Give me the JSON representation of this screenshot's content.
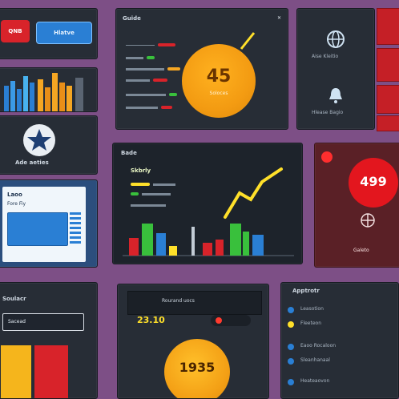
{
  "top_left": {
    "button_a": "QNB",
    "button_b": "Hlatve"
  },
  "gauge_panel": {
    "title": "Guide",
    "value": "45",
    "caption": "Soloces"
  },
  "icon_panel": {
    "item1": "Aise Kleitio",
    "item2": "Hlease Bagio"
  },
  "mid_left": {
    "label": "Ade aeties"
  },
  "form_panel": {
    "title": "Laoo",
    "field": "Fore Fiy"
  },
  "chart_panel": {
    "title": "Bade",
    "subtitle": "Skbrly"
  },
  "alert_panel": {
    "value": "499",
    "caption": "Galeto"
  },
  "bottom_left": {
    "title": "Soulacr",
    "input": "Sacead"
  },
  "bottom_center": {
    "header": "Rourand uocs",
    "value": "23.10",
    "gauge": "1935"
  },
  "bottom_right": {
    "title": "Apptrotr",
    "items": [
      "Leasotion",
      "Fleeteon",
      "Eaoo Rocaloon",
      "Sleanhanaal",
      "Heateaovon"
    ]
  },
  "colors": {
    "accent_orange": "#f5a623",
    "accent_red": "#d8232a",
    "accent_blue": "#2a7fd4",
    "accent_green": "#39c03c",
    "accent_yellow": "#ffe02a"
  }
}
